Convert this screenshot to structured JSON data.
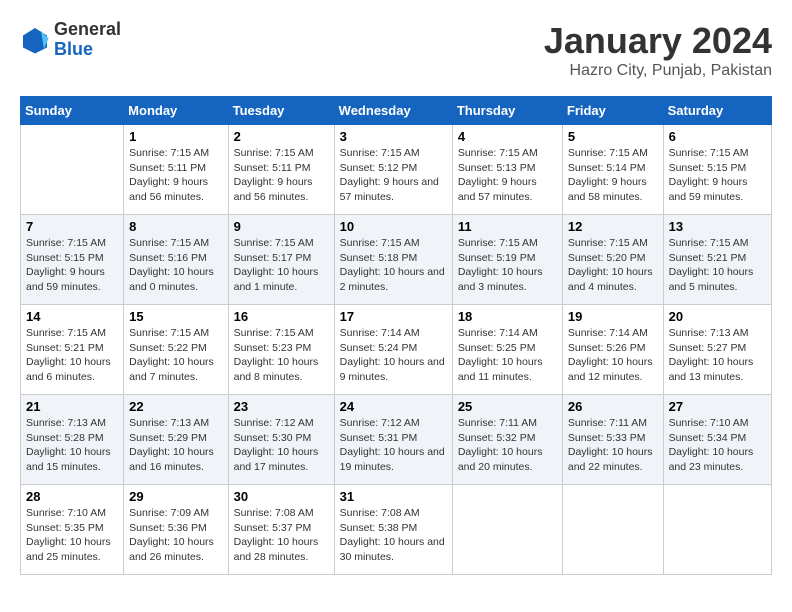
{
  "logo": {
    "line1": "General",
    "line2": "Blue"
  },
  "title": "January 2024",
  "subtitle": "Hazro City, Punjab, Pakistan",
  "days_of_week": [
    "Sunday",
    "Monday",
    "Tuesday",
    "Wednesday",
    "Thursday",
    "Friday",
    "Saturday"
  ],
  "weeks": [
    [
      {
        "day": "",
        "sunrise": "",
        "sunset": "",
        "daylight": ""
      },
      {
        "day": "1",
        "sunrise": "Sunrise: 7:15 AM",
        "sunset": "Sunset: 5:11 PM",
        "daylight": "Daylight: 9 hours and 56 minutes."
      },
      {
        "day": "2",
        "sunrise": "Sunrise: 7:15 AM",
        "sunset": "Sunset: 5:11 PM",
        "daylight": "Daylight: 9 hours and 56 minutes."
      },
      {
        "day": "3",
        "sunrise": "Sunrise: 7:15 AM",
        "sunset": "Sunset: 5:12 PM",
        "daylight": "Daylight: 9 hours and 57 minutes."
      },
      {
        "day": "4",
        "sunrise": "Sunrise: 7:15 AM",
        "sunset": "Sunset: 5:13 PM",
        "daylight": "Daylight: 9 hours and 57 minutes."
      },
      {
        "day": "5",
        "sunrise": "Sunrise: 7:15 AM",
        "sunset": "Sunset: 5:14 PM",
        "daylight": "Daylight: 9 hours and 58 minutes."
      },
      {
        "day": "6",
        "sunrise": "Sunrise: 7:15 AM",
        "sunset": "Sunset: 5:15 PM",
        "daylight": "Daylight: 9 hours and 59 minutes."
      }
    ],
    [
      {
        "day": "7",
        "sunrise": "Sunrise: 7:15 AM",
        "sunset": "Sunset: 5:15 PM",
        "daylight": "Daylight: 9 hours and 59 minutes."
      },
      {
        "day": "8",
        "sunrise": "Sunrise: 7:15 AM",
        "sunset": "Sunset: 5:16 PM",
        "daylight": "Daylight: 10 hours and 0 minutes."
      },
      {
        "day": "9",
        "sunrise": "Sunrise: 7:15 AM",
        "sunset": "Sunset: 5:17 PM",
        "daylight": "Daylight: 10 hours and 1 minute."
      },
      {
        "day": "10",
        "sunrise": "Sunrise: 7:15 AM",
        "sunset": "Sunset: 5:18 PM",
        "daylight": "Daylight: 10 hours and 2 minutes."
      },
      {
        "day": "11",
        "sunrise": "Sunrise: 7:15 AM",
        "sunset": "Sunset: 5:19 PM",
        "daylight": "Daylight: 10 hours and 3 minutes."
      },
      {
        "day": "12",
        "sunrise": "Sunrise: 7:15 AM",
        "sunset": "Sunset: 5:20 PM",
        "daylight": "Daylight: 10 hours and 4 minutes."
      },
      {
        "day": "13",
        "sunrise": "Sunrise: 7:15 AM",
        "sunset": "Sunset: 5:21 PM",
        "daylight": "Daylight: 10 hours and 5 minutes."
      }
    ],
    [
      {
        "day": "14",
        "sunrise": "Sunrise: 7:15 AM",
        "sunset": "Sunset: 5:21 PM",
        "daylight": "Daylight: 10 hours and 6 minutes."
      },
      {
        "day": "15",
        "sunrise": "Sunrise: 7:15 AM",
        "sunset": "Sunset: 5:22 PM",
        "daylight": "Daylight: 10 hours and 7 minutes."
      },
      {
        "day": "16",
        "sunrise": "Sunrise: 7:15 AM",
        "sunset": "Sunset: 5:23 PM",
        "daylight": "Daylight: 10 hours and 8 minutes."
      },
      {
        "day": "17",
        "sunrise": "Sunrise: 7:14 AM",
        "sunset": "Sunset: 5:24 PM",
        "daylight": "Daylight: 10 hours and 9 minutes."
      },
      {
        "day": "18",
        "sunrise": "Sunrise: 7:14 AM",
        "sunset": "Sunset: 5:25 PM",
        "daylight": "Daylight: 10 hours and 11 minutes."
      },
      {
        "day": "19",
        "sunrise": "Sunrise: 7:14 AM",
        "sunset": "Sunset: 5:26 PM",
        "daylight": "Daylight: 10 hours and 12 minutes."
      },
      {
        "day": "20",
        "sunrise": "Sunrise: 7:13 AM",
        "sunset": "Sunset: 5:27 PM",
        "daylight": "Daylight: 10 hours and 13 minutes."
      }
    ],
    [
      {
        "day": "21",
        "sunrise": "Sunrise: 7:13 AM",
        "sunset": "Sunset: 5:28 PM",
        "daylight": "Daylight: 10 hours and 15 minutes."
      },
      {
        "day": "22",
        "sunrise": "Sunrise: 7:13 AM",
        "sunset": "Sunset: 5:29 PM",
        "daylight": "Daylight: 10 hours and 16 minutes."
      },
      {
        "day": "23",
        "sunrise": "Sunrise: 7:12 AM",
        "sunset": "Sunset: 5:30 PM",
        "daylight": "Daylight: 10 hours and 17 minutes."
      },
      {
        "day": "24",
        "sunrise": "Sunrise: 7:12 AM",
        "sunset": "Sunset: 5:31 PM",
        "daylight": "Daylight: 10 hours and 19 minutes."
      },
      {
        "day": "25",
        "sunrise": "Sunrise: 7:11 AM",
        "sunset": "Sunset: 5:32 PM",
        "daylight": "Daylight: 10 hours and 20 minutes."
      },
      {
        "day": "26",
        "sunrise": "Sunrise: 7:11 AM",
        "sunset": "Sunset: 5:33 PM",
        "daylight": "Daylight: 10 hours and 22 minutes."
      },
      {
        "day": "27",
        "sunrise": "Sunrise: 7:10 AM",
        "sunset": "Sunset: 5:34 PM",
        "daylight": "Daylight: 10 hours and 23 minutes."
      }
    ],
    [
      {
        "day": "28",
        "sunrise": "Sunrise: 7:10 AM",
        "sunset": "Sunset: 5:35 PM",
        "daylight": "Daylight: 10 hours and 25 minutes."
      },
      {
        "day": "29",
        "sunrise": "Sunrise: 7:09 AM",
        "sunset": "Sunset: 5:36 PM",
        "daylight": "Daylight: 10 hours and 26 minutes."
      },
      {
        "day": "30",
        "sunrise": "Sunrise: 7:08 AM",
        "sunset": "Sunset: 5:37 PM",
        "daylight": "Daylight: 10 hours and 28 minutes."
      },
      {
        "day": "31",
        "sunrise": "Sunrise: 7:08 AM",
        "sunset": "Sunset: 5:38 PM",
        "daylight": "Daylight: 10 hours and 30 minutes."
      },
      {
        "day": "",
        "sunrise": "",
        "sunset": "",
        "daylight": ""
      },
      {
        "day": "",
        "sunrise": "",
        "sunset": "",
        "daylight": ""
      },
      {
        "day": "",
        "sunrise": "",
        "sunset": "",
        "daylight": ""
      }
    ]
  ]
}
